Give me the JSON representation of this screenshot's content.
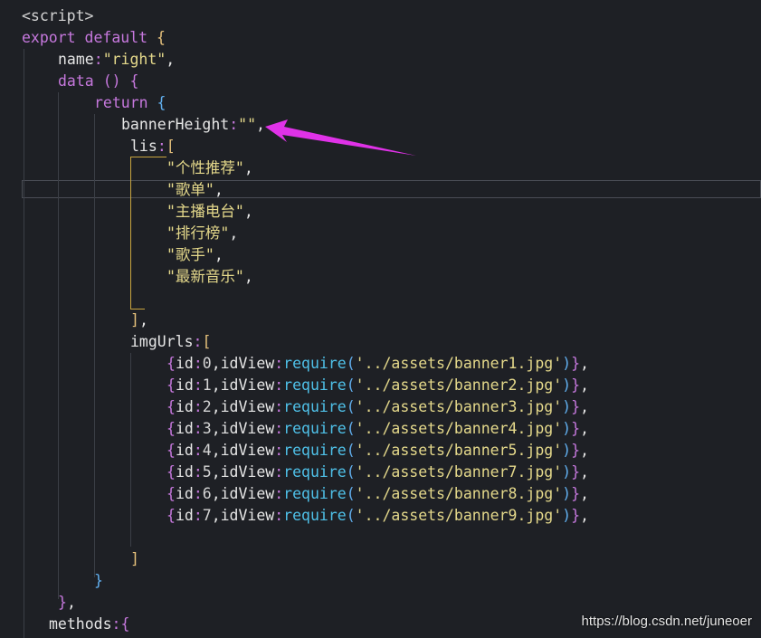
{
  "editor": {
    "lines": [
      {
        "tokens": [
          [
            "<script>",
            "c-tag"
          ]
        ]
      },
      {
        "tokens": [
          [
            "export",
            "c-kw"
          ],
          [
            " ",
            "c-id"
          ],
          [
            "default",
            "c-kw"
          ],
          [
            " ",
            "c-id"
          ],
          [
            "{",
            "c-br1"
          ]
        ]
      },
      {
        "tokens": [
          [
            "name",
            "c-id"
          ],
          [
            ":",
            "c-punct"
          ],
          [
            "\"right\"",
            "c-str"
          ],
          [
            ",",
            "c-id"
          ]
        ]
      },
      {
        "tokens": [
          [
            "data",
            "c-kw2"
          ],
          [
            " ",
            "c-id"
          ],
          [
            "()",
            "c-br2"
          ],
          [
            " ",
            "c-id"
          ],
          [
            "{",
            "c-br2"
          ]
        ]
      },
      {
        "tokens": [
          [
            "return",
            "c-kw"
          ],
          [
            " ",
            "c-id"
          ],
          [
            "{",
            "c-br3"
          ]
        ]
      },
      {
        "tokens": [
          [
            "bannerHeight",
            "c-id"
          ],
          [
            ":",
            "c-punct"
          ],
          [
            "\"\"",
            "c-str"
          ],
          [
            ",",
            "c-id"
          ]
        ]
      },
      {
        "tokens": [
          [
            "lis",
            "c-id"
          ],
          [
            ":",
            "c-punct"
          ],
          [
            "[",
            "c-br1"
          ]
        ]
      },
      {
        "tokens": [
          [
            "\"个性推荐\"",
            "c-str"
          ],
          [
            ",",
            "c-id"
          ]
        ]
      },
      {
        "tokens": [
          [
            "\"歌单\"",
            "c-str"
          ],
          [
            ",",
            "c-id"
          ]
        ]
      },
      {
        "tokens": [
          [
            "\"主播电台\"",
            "c-str"
          ],
          [
            ",",
            "c-id"
          ]
        ]
      },
      {
        "tokens": [
          [
            "\"排行榜\"",
            "c-str"
          ],
          [
            ",",
            "c-id"
          ]
        ]
      },
      {
        "tokens": [
          [
            "\"歌手\"",
            "c-str"
          ],
          [
            ",",
            "c-id"
          ]
        ]
      },
      {
        "tokens": [
          [
            "\"最新音乐\"",
            "c-str"
          ],
          [
            ",",
            "c-id"
          ]
        ]
      },
      {
        "tokens": []
      },
      {
        "tokens": [
          [
            "]",
            "c-br1"
          ],
          [
            ",",
            "c-id"
          ]
        ]
      },
      {
        "tokens": [
          [
            "imgUrls",
            "c-id"
          ],
          [
            ":",
            "c-punct"
          ],
          [
            "[",
            "c-br1"
          ]
        ]
      },
      {
        "tokens": [
          [
            "{",
            "c-br2"
          ],
          [
            "id",
            "c-id"
          ],
          [
            ":",
            "c-punct"
          ],
          [
            "0",
            "c-num"
          ],
          [
            ",",
            "c-id"
          ],
          [
            "idView",
            "c-id"
          ],
          [
            ":",
            "c-punct"
          ],
          [
            "require",
            "c-fn"
          ],
          [
            "(",
            "c-br3"
          ],
          [
            "'../assets/banner1.jpg'",
            "c-str"
          ],
          [
            ")",
            "c-br3"
          ],
          [
            "}",
            "c-br2"
          ],
          [
            ",",
            "c-id"
          ]
        ]
      },
      {
        "tokens": [
          [
            "{",
            "c-br2"
          ],
          [
            "id",
            "c-id"
          ],
          [
            ":",
            "c-punct"
          ],
          [
            "1",
            "c-num"
          ],
          [
            ",",
            "c-id"
          ],
          [
            "idView",
            "c-id"
          ],
          [
            ":",
            "c-punct"
          ],
          [
            "require",
            "c-fn"
          ],
          [
            "(",
            "c-br3"
          ],
          [
            "'../assets/banner2.jpg'",
            "c-str"
          ],
          [
            ")",
            "c-br3"
          ],
          [
            "}",
            "c-br2"
          ],
          [
            ",",
            "c-id"
          ]
        ]
      },
      {
        "tokens": [
          [
            "{",
            "c-br2"
          ],
          [
            "id",
            "c-id"
          ],
          [
            ":",
            "c-punct"
          ],
          [
            "2",
            "c-num"
          ],
          [
            ",",
            "c-id"
          ],
          [
            "idView",
            "c-id"
          ],
          [
            ":",
            "c-punct"
          ],
          [
            "require",
            "c-fn"
          ],
          [
            "(",
            "c-br3"
          ],
          [
            "'../assets/banner3.jpg'",
            "c-str"
          ],
          [
            ")",
            "c-br3"
          ],
          [
            "}",
            "c-br2"
          ],
          [
            ",",
            "c-id"
          ]
        ]
      },
      {
        "tokens": [
          [
            "{",
            "c-br2"
          ],
          [
            "id",
            "c-id"
          ],
          [
            ":",
            "c-punct"
          ],
          [
            "3",
            "c-num"
          ],
          [
            ",",
            "c-id"
          ],
          [
            "idView",
            "c-id"
          ],
          [
            ":",
            "c-punct"
          ],
          [
            "require",
            "c-fn"
          ],
          [
            "(",
            "c-br3"
          ],
          [
            "'../assets/banner4.jpg'",
            "c-str"
          ],
          [
            ")",
            "c-br3"
          ],
          [
            "}",
            "c-br2"
          ],
          [
            ",",
            "c-id"
          ]
        ]
      },
      {
        "tokens": [
          [
            "{",
            "c-br2"
          ],
          [
            "id",
            "c-id"
          ],
          [
            ":",
            "c-punct"
          ],
          [
            "4",
            "c-num"
          ],
          [
            ",",
            "c-id"
          ],
          [
            "idView",
            "c-id"
          ],
          [
            ":",
            "c-punct"
          ],
          [
            "require",
            "c-fn"
          ],
          [
            "(",
            "c-br3"
          ],
          [
            "'../assets/banner5.jpg'",
            "c-str"
          ],
          [
            ")",
            "c-br3"
          ],
          [
            "}",
            "c-br2"
          ],
          [
            ",",
            "c-id"
          ]
        ]
      },
      {
        "tokens": [
          [
            "{",
            "c-br2"
          ],
          [
            "id",
            "c-id"
          ],
          [
            ":",
            "c-punct"
          ],
          [
            "5",
            "c-num"
          ],
          [
            ",",
            "c-id"
          ],
          [
            "idView",
            "c-id"
          ],
          [
            ":",
            "c-punct"
          ],
          [
            "require",
            "c-fn"
          ],
          [
            "(",
            "c-br3"
          ],
          [
            "'../assets/banner7.jpg'",
            "c-str"
          ],
          [
            ")",
            "c-br3"
          ],
          [
            "}",
            "c-br2"
          ],
          [
            ",",
            "c-id"
          ]
        ]
      },
      {
        "tokens": [
          [
            "{",
            "c-br2"
          ],
          [
            "id",
            "c-id"
          ],
          [
            ":",
            "c-punct"
          ],
          [
            "6",
            "c-num"
          ],
          [
            ",",
            "c-id"
          ],
          [
            "idView",
            "c-id"
          ],
          [
            ":",
            "c-punct"
          ],
          [
            "require",
            "c-fn"
          ],
          [
            "(",
            "c-br3"
          ],
          [
            "'../assets/banner8.jpg'",
            "c-str"
          ],
          [
            ")",
            "c-br3"
          ],
          [
            "}",
            "c-br2"
          ],
          [
            ",",
            "c-id"
          ]
        ]
      },
      {
        "tokens": [
          [
            "{",
            "c-br2"
          ],
          [
            "id",
            "c-id"
          ],
          [
            ":",
            "c-punct"
          ],
          [
            "7",
            "c-num"
          ],
          [
            ",",
            "c-id"
          ],
          [
            "idView",
            "c-id"
          ],
          [
            ":",
            "c-punct"
          ],
          [
            "require",
            "c-fn"
          ],
          [
            "(",
            "c-br3"
          ],
          [
            "'../assets/banner9.jpg'",
            "c-str"
          ],
          [
            ")",
            "c-br3"
          ],
          [
            "}",
            "c-br2"
          ],
          [
            ",",
            "c-id"
          ]
        ]
      },
      {
        "tokens": []
      },
      {
        "tokens": [
          [
            "]",
            "c-br1"
          ]
        ]
      },
      {
        "tokens": [
          [
            "}",
            "c-br3"
          ]
        ]
      },
      {
        "tokens": [
          [
            "}",
            "c-br2"
          ],
          [
            ",",
            "c-id"
          ]
        ]
      },
      {
        "tokens": [
          [
            "methods",
            "c-id"
          ],
          [
            ":",
            "c-punct"
          ],
          [
            "{",
            "c-br2"
          ]
        ]
      }
    ]
  },
  "annotation": {
    "color": "#e032e8",
    "icon": "arrow-icon"
  },
  "watermark": {
    "text": "https://blog.csdn.net/juneoer"
  }
}
